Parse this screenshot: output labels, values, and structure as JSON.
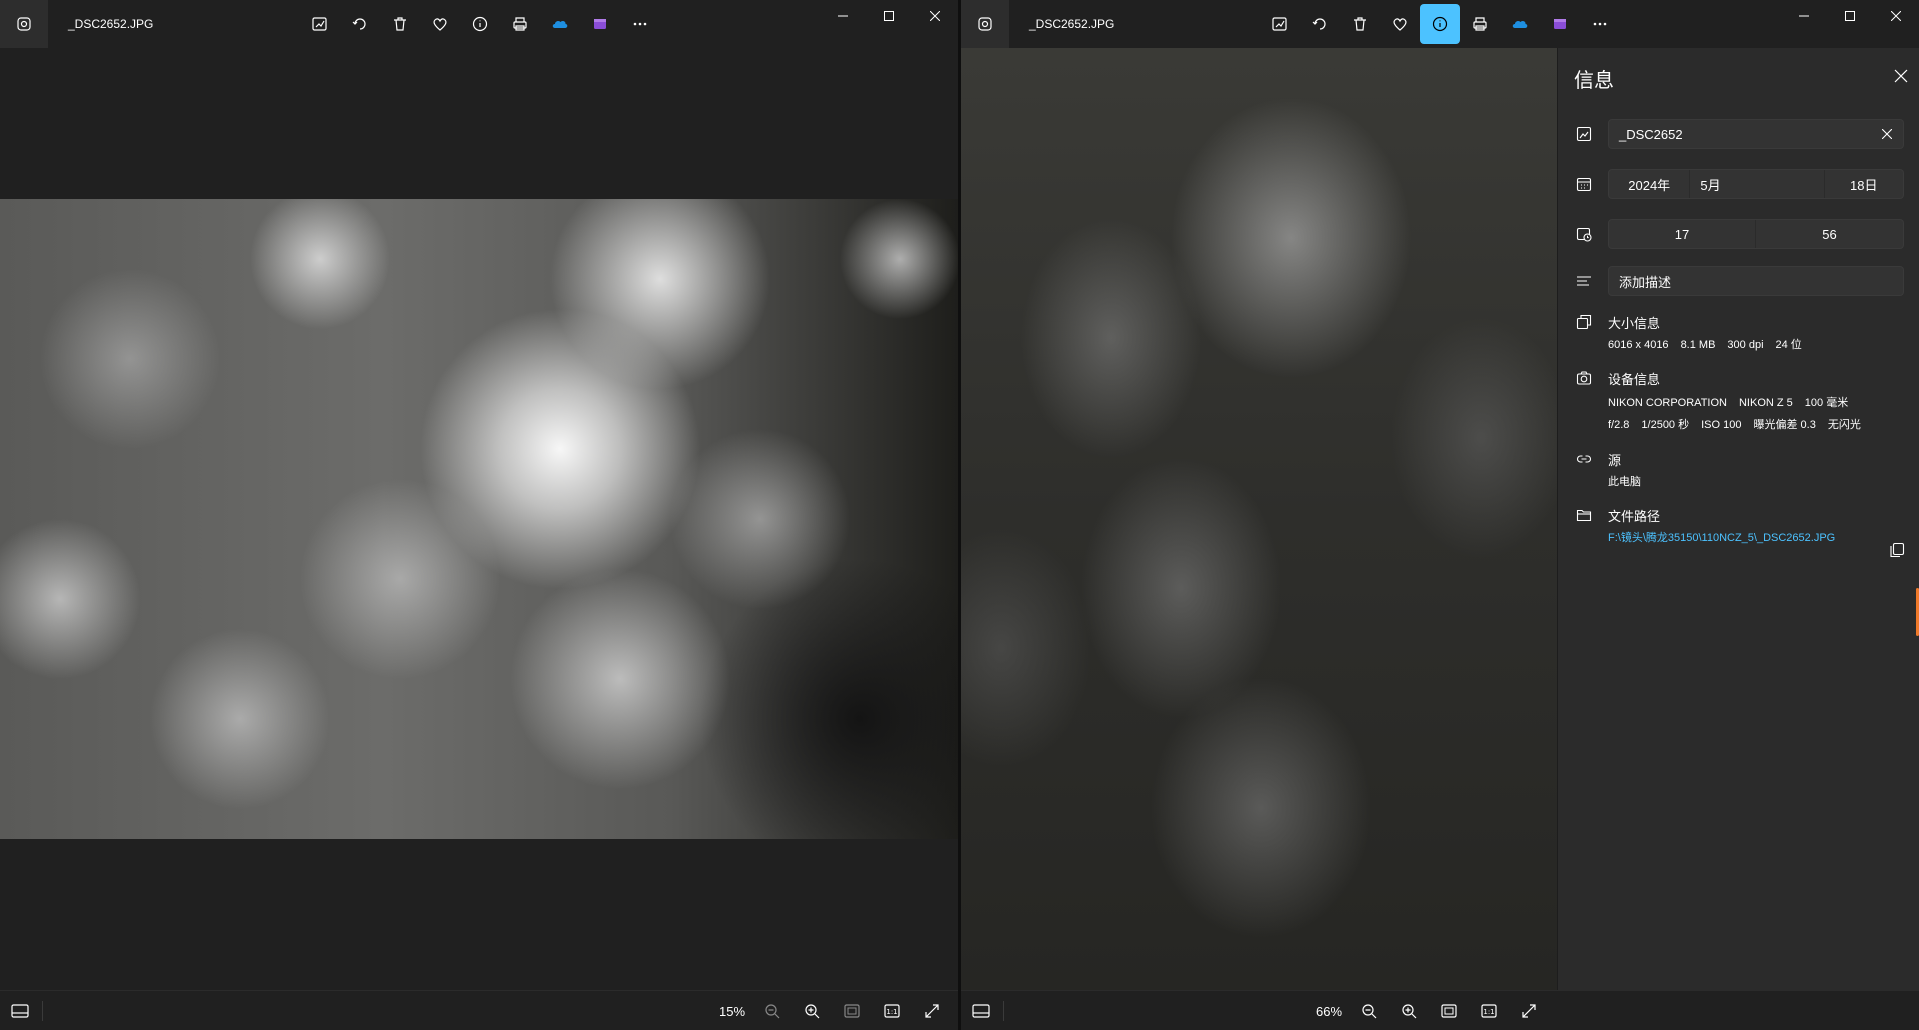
{
  "left_window": {
    "filename": "_DSC2652.JPG",
    "zoom": "15%"
  },
  "right_window": {
    "filename": "_DSC2652.JPG",
    "zoom": "66%"
  },
  "toolbar_icons": [
    "edit-image-icon",
    "rotate-icon",
    "delete-icon",
    "favorite-icon",
    "info-icon",
    "print-icon",
    "onedrive-icon",
    "clipchamp-icon",
    "more-icon"
  ],
  "info": {
    "title": "信息",
    "name_value": "_DSC2652",
    "date": {
      "year": "2024年",
      "month": "5月",
      "day": "18日"
    },
    "time": {
      "hour": "17",
      "minute": "56"
    },
    "description_placeholder": "添加描述",
    "size": {
      "title": "大小信息",
      "dimensions": "6016 x 4016",
      "filesize": "8.1 MB",
      "dpi": "300 dpi",
      "bits": "24 位"
    },
    "camera": {
      "title": "设备信息",
      "make": "NIKON CORPORATION",
      "model": "NIKON Z 5",
      "focal": "100 毫米",
      "aperture": "f/2.8",
      "shutter": "1/2500 秒",
      "iso": "ISO 100",
      "exposure": "曝光偏差 0.3",
      "flash": "无闪光"
    },
    "source": {
      "title": "源",
      "value": "此电脑"
    },
    "path": {
      "title": "文件路径",
      "value": "F:\\镜头\\腾龙35150\\110NCZ_5\\_DSC2652.JPG"
    }
  },
  "colors": {
    "accent": "#4cc2ff",
    "window_bg": "#202020",
    "panel_bg": "#2b2b2b"
  }
}
